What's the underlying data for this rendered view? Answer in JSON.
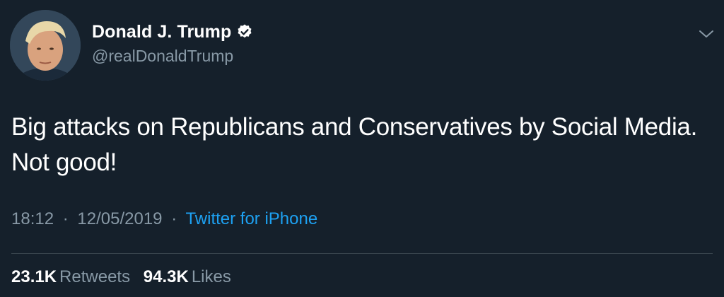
{
  "author": {
    "display_name": "Donald J. Trump",
    "handle": "@realDonaldTrump",
    "verified_icon": "verified-badge-icon",
    "avatar_icon": "profile-avatar"
  },
  "tweet": {
    "lines": [
      "Big attacks on Republicans and Conservatives by Social Media.",
      "Not good!"
    ],
    "time": "18:12",
    "date": "12/05/2019",
    "separator": "·",
    "source": "Twitter for iPhone"
  },
  "stats": {
    "retweets_count": "23.1K",
    "retweets_label": "Retweets",
    "likes_count": "94.3K",
    "likes_label": "Likes"
  },
  "menu": {
    "icon": "chevron-down-icon"
  },
  "colors": {
    "background": "#15202b",
    "primary_text": "#ffffff",
    "secondary_text": "#8899a6",
    "link": "#1da1f2",
    "divider": "#38444d"
  }
}
